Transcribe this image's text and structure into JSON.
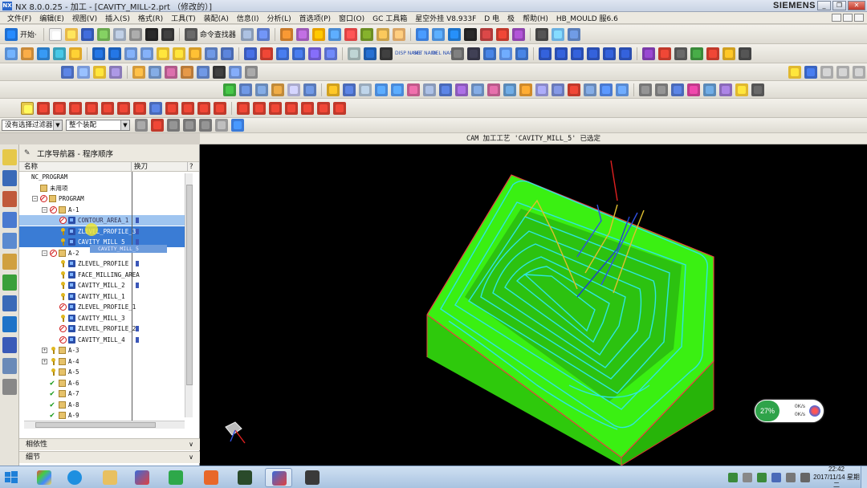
{
  "window": {
    "title": "NX 8.0.0.25 - 加工 - [CAVITY_MILL-2.prt （修改的）]",
    "brand": "SIEMENS",
    "minimize": "_",
    "restore": "❐",
    "close": "✕"
  },
  "menu": [
    "文件(F)",
    "编辑(E)",
    "视图(V)",
    "插入(S)",
    "格式(R)",
    "工具(T)",
    "装配(A)",
    "信息(I)",
    "分析(L)",
    "首选项(P)",
    "窗口(O)",
    "GC 工具箱",
    "星空外挂 V8.933F",
    "D 电",
    "极",
    "帮助(H)",
    "HB_MOULD 服6.6"
  ],
  "toolbar": {
    "start_label": "开始·",
    "command_finder": "命令查找器",
    "filter_combo": "没有选择过滤器",
    "assembly_combo": "整个装配",
    "disp": "DISP NAME",
    "set": "SET NAME",
    "del": "DEL NAME"
  },
  "cam_status": "CAM 加工工艺 'CAVITY_MILL_5' 已选定",
  "navigator": {
    "title": "工序导航器 - 程序顺序",
    "col_name": "名称",
    "col_tool": "换刀",
    "col_more": "?",
    "drag_tip": "CAVITY_MILL_5",
    "rows": [
      {
        "label": "NC_PROGRAM",
        "indent": 0,
        "icon": "none",
        "exp": "",
        "tool": false,
        "state": ""
      },
      {
        "label": "未用项",
        "indent": 1,
        "icon": "fold",
        "exp": "",
        "tool": false,
        "state": ""
      },
      {
        "label": "PROGRAM",
        "indent": 1,
        "icon": "no",
        "exp": "−",
        "tool": false,
        "state": ""
      },
      {
        "label": "A-1",
        "indent": 2,
        "icon": "no",
        "exp": "−",
        "tool": false,
        "state": ""
      },
      {
        "label": "CONTOUR_AREA_1",
        "indent": 3,
        "icon": "no",
        "exp": "",
        "tool": true,
        "state": "hl"
      },
      {
        "label": "ZLEVEL_PROFILE_3",
        "indent": 3,
        "icon": "key",
        "exp": "",
        "tool": true,
        "state": "sel"
      },
      {
        "label": "CAVITY_MILL_5",
        "indent": 3,
        "icon": "key",
        "exp": "",
        "tool": true,
        "state": "sel"
      },
      {
        "label": "A-2",
        "indent": 2,
        "icon": "no",
        "exp": "−",
        "tool": false,
        "state": ""
      },
      {
        "label": "ZLEVEL_PROFILE",
        "indent": 3,
        "icon": "key",
        "exp": "",
        "tool": true,
        "state": ""
      },
      {
        "label": "FACE_MILLING_AREA",
        "indent": 3,
        "icon": "key",
        "exp": "",
        "tool": false,
        "state": ""
      },
      {
        "label": "CAVITY_MILL_2",
        "indent": 3,
        "icon": "key",
        "exp": "",
        "tool": true,
        "state": ""
      },
      {
        "label": "CAVITY_MILL_1",
        "indent": 3,
        "icon": "key",
        "exp": "",
        "tool": false,
        "state": ""
      },
      {
        "label": "ZLEVEL_PROFILE_1",
        "indent": 3,
        "icon": "no",
        "exp": "",
        "tool": false,
        "state": ""
      },
      {
        "label": "CAVITY_MILL_3",
        "indent": 3,
        "icon": "key",
        "exp": "",
        "tool": false,
        "state": ""
      },
      {
        "label": "ZLEVEL_PROFILE_2",
        "indent": 3,
        "icon": "no",
        "exp": "",
        "tool": true,
        "state": ""
      },
      {
        "label": "CAVITY_MILL_4",
        "indent": 3,
        "icon": "no",
        "exp": "",
        "tool": true,
        "state": ""
      },
      {
        "label": "A-3",
        "indent": 2,
        "icon": "key",
        "exp": "+",
        "tool": false,
        "state": ""
      },
      {
        "label": "A-4",
        "indent": 2,
        "icon": "key",
        "exp": "+",
        "tool": false,
        "state": ""
      },
      {
        "label": "A-5",
        "indent": 2,
        "icon": "key",
        "exp": "",
        "tool": false,
        "state": ""
      },
      {
        "label": "A-6",
        "indent": 2,
        "icon": "ok",
        "exp": "",
        "tool": false,
        "state": ""
      },
      {
        "label": "A-7",
        "indent": 2,
        "icon": "ok",
        "exp": "",
        "tool": false,
        "state": ""
      },
      {
        "label": "A-8",
        "indent": 2,
        "icon": "ok",
        "exp": "",
        "tool": false,
        "state": ""
      },
      {
        "label": "A-9",
        "indent": 2,
        "icon": "ok",
        "exp": "",
        "tool": false,
        "state": ""
      }
    ],
    "panel_dependencies": "相依性",
    "panel_details": "细节"
  },
  "network": {
    "percent": "27%",
    "up": "0K/s",
    "down": "0K/s"
  },
  "taskbar": {
    "time": "22:42",
    "date": "2017/11/14 星期二"
  },
  "colors": {
    "selection": "#3a7cd5",
    "part_green": "#35e10f",
    "toolpath": "#2fe6e0",
    "background": "#000000"
  }
}
